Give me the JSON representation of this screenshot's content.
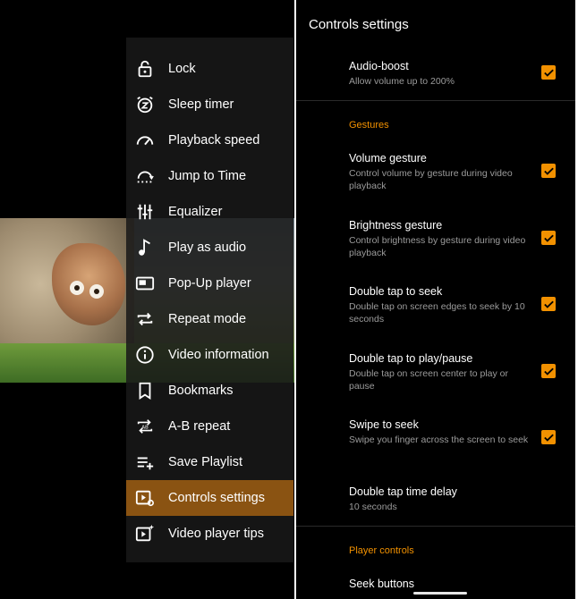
{
  "menu": {
    "items": [
      {
        "label": "Lock",
        "icon": "lock-icon",
        "active": false
      },
      {
        "label": "Sleep timer",
        "icon": "sleep-timer-icon",
        "active": false
      },
      {
        "label": "Playback speed",
        "icon": "speedometer-icon",
        "active": false
      },
      {
        "label": "Jump to Time",
        "icon": "jump-to-time-icon",
        "active": false
      },
      {
        "label": "Equalizer",
        "icon": "equalizer-icon",
        "active": false
      },
      {
        "label": "Play as audio",
        "icon": "music-note-icon",
        "active": false
      },
      {
        "label": "Pop-Up player",
        "icon": "popup-player-icon",
        "active": false
      },
      {
        "label": "Repeat mode",
        "icon": "repeat-icon",
        "active": false
      },
      {
        "label": "Video information",
        "icon": "info-icon",
        "active": false
      },
      {
        "label": "Bookmarks",
        "icon": "bookmark-icon",
        "active": false
      },
      {
        "label": "A-B repeat",
        "icon": "ab-repeat-icon",
        "active": false
      },
      {
        "label": "Save Playlist",
        "icon": "playlist-add-icon",
        "active": false
      },
      {
        "label": "Controls settings",
        "icon": "controls-settings-icon",
        "active": true
      },
      {
        "label": "Video player tips",
        "icon": "video-tips-icon",
        "active": false
      }
    ]
  },
  "settings": {
    "title": "Controls settings",
    "audio_boost": {
      "title": "Audio-boost",
      "subtitle": "Allow volume up to 200%",
      "checked": true
    },
    "gestures_header": "Gestures",
    "volume_gesture": {
      "title": "Volume gesture",
      "subtitle": "Control volume by gesture during video playback",
      "checked": true
    },
    "brightness_gesture": {
      "title": "Brightness gesture",
      "subtitle": "Control brightness by gesture during video playback",
      "checked": true
    },
    "double_tap_seek": {
      "title": "Double tap to seek",
      "subtitle": "Double tap on screen edges to seek by 10 seconds",
      "checked": true
    },
    "double_tap_play": {
      "title": "Double tap to play/pause",
      "subtitle": "Double tap on screen center to play or pause",
      "checked": true
    },
    "swipe_seek": {
      "title": "Swipe to seek",
      "subtitle": "Swipe you finger across the screen to seek",
      "checked": true
    },
    "tap_delay": {
      "title": "Double tap time delay",
      "subtitle": "10 seconds"
    },
    "player_controls_header": "Player controls",
    "seek_buttons": {
      "title": "Seek buttons"
    }
  },
  "colors": {
    "accent": "#f29100",
    "active_menu": "#8a5312",
    "background": "#000000"
  }
}
